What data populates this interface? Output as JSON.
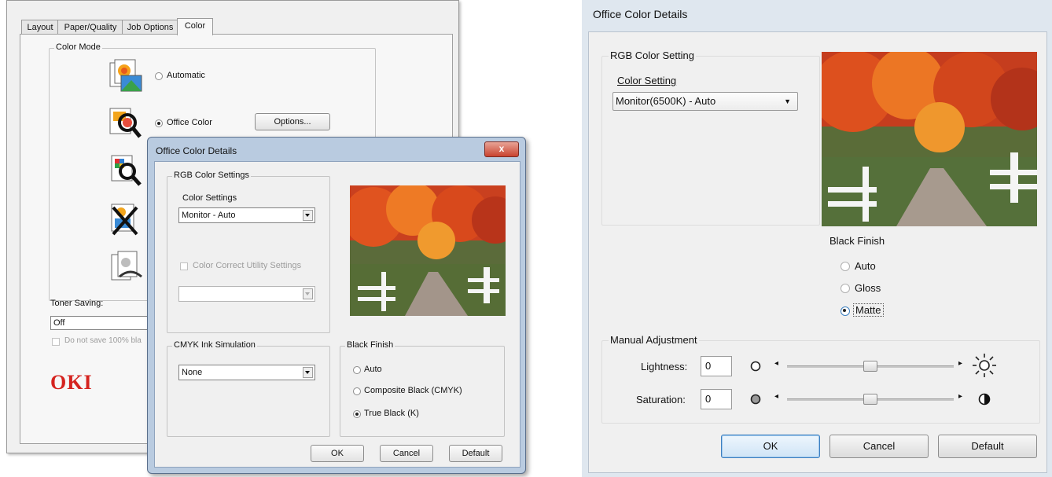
{
  "left_panel": {
    "tabs": [
      "Layout",
      "Paper/Quality",
      "Job Options",
      "Color"
    ],
    "color_mode_label": "Color Mode",
    "modes": {
      "automatic": "Automatic",
      "office_color": "Office Color",
      "options_button": "Options..."
    },
    "toner_saving_label": "Toner Saving:",
    "toner_saving_value": "Off",
    "do_not_save_label": "Do not save 100% bla",
    "brand_logo": "OKI"
  },
  "overlay_dialog": {
    "title": "Office Color Details",
    "close_symbol": "x",
    "rgb_group": "RGB Color Settings",
    "color_settings_label": "Color Settings",
    "color_settings_value": "Monitor - Auto",
    "color_correct_label": "Color Correct Utility Settings",
    "cmyk_group": "CMYK Ink Simulation",
    "cmyk_value": "None",
    "black_finish_group": "Black Finish",
    "black_finish_options": [
      "Auto",
      "Composite Black (CMYK)",
      "True Black (K)"
    ],
    "black_finish_selected": "True Black (K)",
    "buttons": {
      "ok": "OK",
      "cancel": "Cancel",
      "default": "Default"
    }
  },
  "right_dialog": {
    "title": "Office Color Details",
    "rgb_group": "RGB Color Setting",
    "color_setting_label": "Color Setting",
    "color_setting_value": "Monitor(6500K) - Auto",
    "black_finish_label": "Black Finish",
    "black_finish_options": [
      "Auto",
      "Gloss",
      "Matte"
    ],
    "black_finish_selected": "Matte",
    "manual_adjustment_label": "Manual Adjustment",
    "lightness_label": "Lightness:",
    "lightness_value": "0",
    "saturation_label": "Saturation:",
    "saturation_value": "0",
    "lightness_level": 0.5,
    "saturation_level": 0.5,
    "buttons": {
      "ok": "OK",
      "cancel": "Cancel",
      "default": "Default"
    }
  },
  "colors": {
    "oki_red": "#d5231f",
    "title_bar": "#b9cbe0",
    "close_red": "#c9432f",
    "accent_blue": "#3c7fc0"
  },
  "icons": [
    "automatic-mode-icon",
    "office-color-mode-icon",
    "graphic-pro-mode-icon",
    "no-color-matching-icon",
    "grayscale-mode-icon",
    "preview-image",
    "sun-icon",
    "contrast-icon"
  ]
}
